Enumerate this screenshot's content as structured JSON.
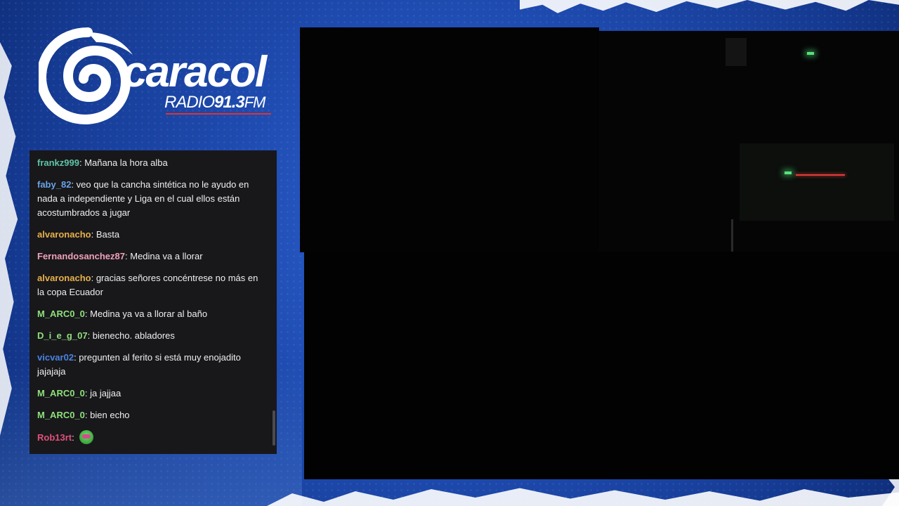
{
  "brand": {
    "name": "caracol",
    "radio_label": "RADIO",
    "frequency": "91.3",
    "band": "FM",
    "accent_color": "#e4322b",
    "background_color": "#1f4db4"
  },
  "chat": {
    "messages": [
      {
        "user": "frankz999",
        "color": "#5ec4a6",
        "text": "Mañana la hora alba"
      },
      {
        "user": "faby_82",
        "color": "#6aa3e8",
        "text": "veo que la cancha sintética no le ayudo en nada a independiente y Liga en el cual ellos están acostumbrados a jugar"
      },
      {
        "user": "alvaronacho",
        "color": "#e8b04a",
        "text": "Basta"
      },
      {
        "user": "Fernandosanchez87",
        "color": "#f0a0b8",
        "text": "Medina va a llorar"
      },
      {
        "user": "alvaronacho",
        "color": "#e8b04a",
        "text": "gracias señores concéntrese no más en la copa Ecuador"
      },
      {
        "user": "M_ARC0_0",
        "color": "#8fe07a",
        "text": "Medina ya va a llorar al baño"
      },
      {
        "user": "D_i_e_g_07",
        "color": "#8fe07a",
        "text": "bienecho. abladores"
      },
      {
        "user": "vicvar02",
        "color": "#4a82e0",
        "text": "pregunten al ferito si está muy enojadito jajajaja"
      },
      {
        "user": "M_ARC0_0",
        "color": "#8fe07a",
        "text": "ja jajjaa"
      },
      {
        "user": "M_ARC0_0",
        "color": "#8fe07a",
        "text": "bien echo"
      },
      {
        "user": "Rob13rt",
        "color": "#e0507a",
        "text": "",
        "emote": "green-face-emote"
      }
    ]
  }
}
